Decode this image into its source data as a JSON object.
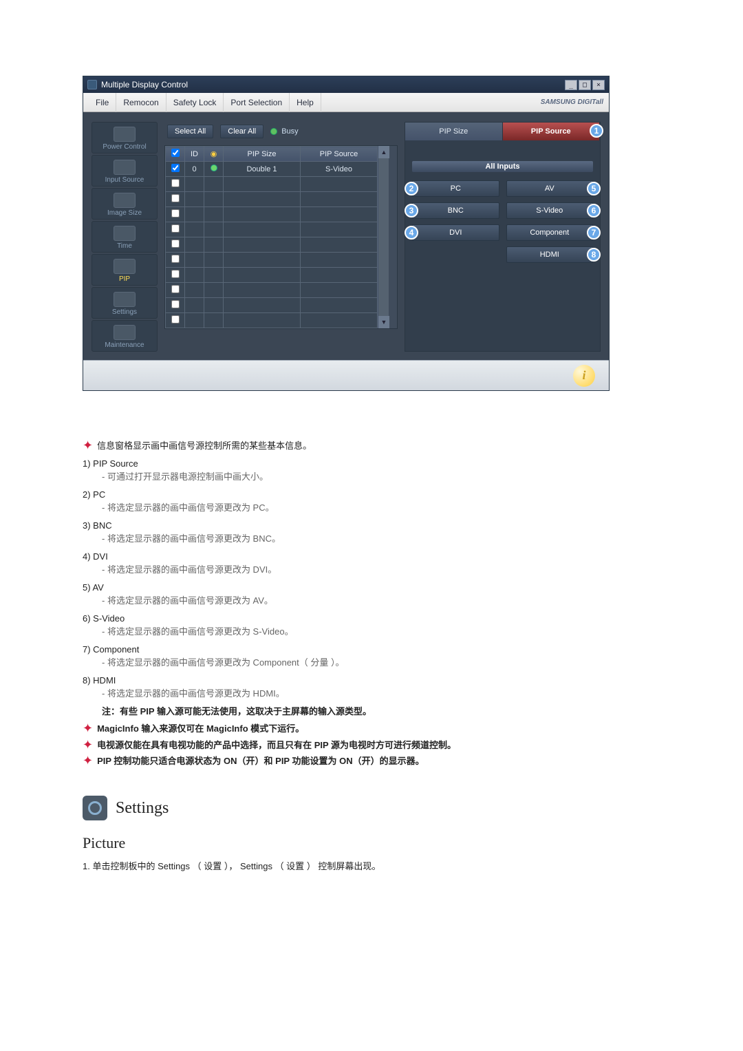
{
  "window": {
    "title": "Multiple Display Control",
    "menu": [
      "File",
      "Remocon",
      "Safety Lock",
      "Port Selection",
      "Help"
    ],
    "brand": "SAMSUNG DIGITall"
  },
  "sidebar": {
    "items": [
      {
        "label": "Power Control"
      },
      {
        "label": "Input Source"
      },
      {
        "label": "Image Size"
      },
      {
        "label": "Time"
      },
      {
        "label": "PIP"
      },
      {
        "label": "Settings"
      },
      {
        "label": "Maintenance"
      }
    ]
  },
  "toolbar": {
    "select_all": "Select All",
    "clear_all": "Clear All",
    "busy": "Busy"
  },
  "table": {
    "headers": {
      "check": "",
      "id": "ID",
      "status": "",
      "pip_size": "PIP Size",
      "pip_source": "PIP Source"
    },
    "row": {
      "id": "0",
      "pip_size": "Double 1",
      "pip_source": "S-Video"
    }
  },
  "right_panel": {
    "tab_size": "PIP Size",
    "tab_source": "PIP Source",
    "badge_1": "1",
    "all_inputs": "All Inputs",
    "left_buttons": [
      {
        "badge": "2",
        "label": "PC"
      },
      {
        "badge": "3",
        "label": "BNC"
      },
      {
        "badge": "4",
        "label": "DVI"
      }
    ],
    "right_buttons": [
      {
        "badge": "5",
        "label": "AV"
      },
      {
        "badge": "6",
        "label": "S-Video"
      },
      {
        "badge": "7",
        "label": "Component"
      },
      {
        "badge": "8",
        "label": "HDMI"
      }
    ]
  },
  "doc": {
    "intro": "信息窗格显示画中画信号源控制所需的某些基本信息。",
    "items": [
      {
        "title": "1) PIP Source",
        "desc": "- 可通过打开显示器电源控制画中画大小。"
      },
      {
        "title": "2) PC",
        "desc": "- 将选定显示器的画中画信号源更改为 PC。"
      },
      {
        "title": "3) BNC",
        "desc": "- 将选定显示器的画中画信号源更改为 BNC。"
      },
      {
        "title": "4) DVI",
        "desc": "- 将选定显示器的画中画信号源更改为 DVI。"
      },
      {
        "title": "5) AV",
        "desc": "- 将选定显示器的画中画信号源更改为 AV。"
      },
      {
        "title": "6) S-Video",
        "desc": "- 将选定显示器的画中画信号源更改为 S-Video。"
      },
      {
        "title": "7) Component",
        "desc": "- 将选定显示器的画中画信号源更改为 Component（ 分量 ）。"
      },
      {
        "title": "8) HDMI",
        "desc": "- 将选定显示器的画中画信号源更改为 HDMI。"
      }
    ],
    "note": "注：有些 PIP 输入源可能无法使用，这取决于主屏幕的输入源类型。",
    "star1": "MagicInfo 输入来源仅可在 MagicInfo 模式下运行。",
    "star2": "电视源仅能在具有电视功能的产品中选择，而且只有在 PIP 源为电视时方可进行频道控制。",
    "star3": "PIP 控制功能只适合电源状态为 ON（开）和 PIP 功能设置为 ON（开）的显示器。",
    "settings_heading": "Settings",
    "picture_heading": "Picture",
    "picture_step": "1. 单击控制板中的 Settings （ 设置 ）， Settings （ 设置 ） 控制屏幕出现。"
  }
}
